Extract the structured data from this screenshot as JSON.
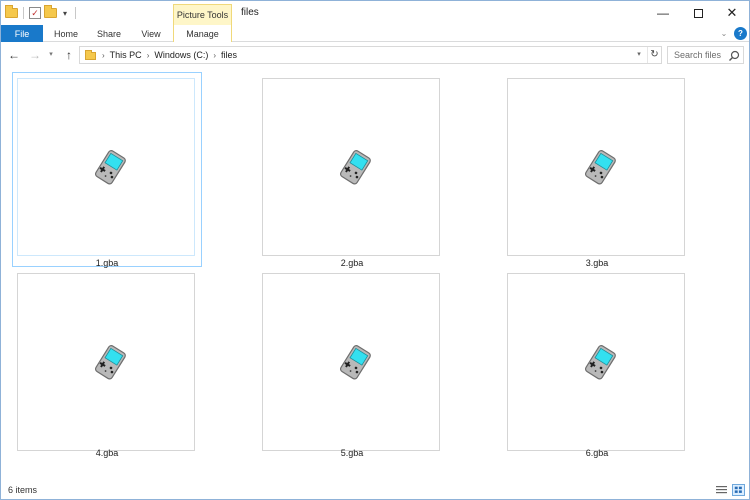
{
  "window": {
    "title": "files",
    "context_tab_group": "Picture Tools"
  },
  "ribbon": {
    "tabs": [
      "File",
      "Home",
      "Share",
      "View",
      "Manage"
    ]
  },
  "address_bar": {
    "breadcrumbs": [
      "This PC",
      "Windows (C:)",
      "files"
    ]
  },
  "search": {
    "placeholder": "Search files"
  },
  "files": [
    {
      "name": "1.gba",
      "selected": true,
      "icon": "gba-file-icon"
    },
    {
      "name": "2.gba",
      "selected": false,
      "icon": "gba-file-icon"
    },
    {
      "name": "3.gba",
      "selected": false,
      "icon": "gba-file-icon"
    },
    {
      "name": "4.gba",
      "selected": false,
      "icon": "gba-file-icon"
    },
    {
      "name": "5.gba",
      "selected": false,
      "icon": "gba-file-icon"
    },
    {
      "name": "6.gba",
      "selected": false,
      "icon": "gba-file-icon"
    }
  ],
  "status": {
    "item_count": "6 items"
  },
  "colors": {
    "file_tab": "#1979ca",
    "context_tab": "#fef6c8",
    "gba_screen": "#33e0f0",
    "gba_body": "#b9b9b9"
  }
}
